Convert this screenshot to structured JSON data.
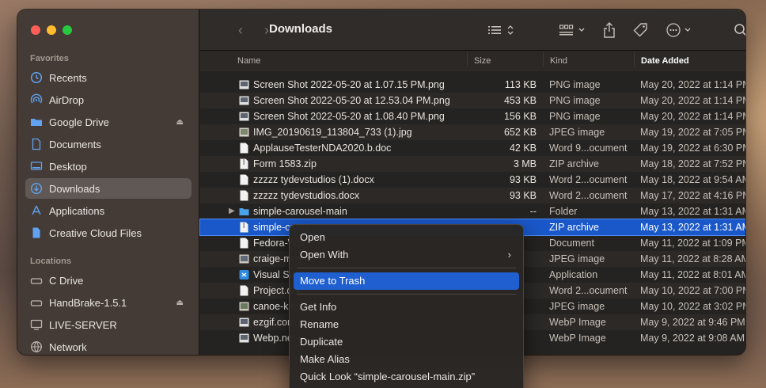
{
  "window": {
    "title": "Downloads"
  },
  "sidebar": {
    "favorites_label": "Favorites",
    "locations_label": "Locations",
    "favorites": [
      {
        "label": "Recents",
        "icon": "clock-icon"
      },
      {
        "label": "AirDrop",
        "icon": "airdrop-icon"
      },
      {
        "label": "Google Drive",
        "icon": "folder-icon",
        "eject": true
      },
      {
        "label": "Documents",
        "icon": "document-icon"
      },
      {
        "label": "Desktop",
        "icon": "desktop-icon"
      },
      {
        "label": "Downloads",
        "icon": "download-icon",
        "active": true
      },
      {
        "label": "Applications",
        "icon": "applications-icon"
      },
      {
        "label": "Creative Cloud Files",
        "icon": "document-icon"
      }
    ],
    "locations": [
      {
        "label": "C Drive",
        "icon": "drive-icon"
      },
      {
        "label": "HandBrake-1.5.1",
        "icon": "drive-icon",
        "eject": true
      },
      {
        "label": "LIVE-SERVER",
        "icon": "monitor-icon"
      },
      {
        "label": "Network",
        "icon": "globe-icon"
      }
    ]
  },
  "columns": {
    "name": "Name",
    "size": "Size",
    "kind": "Kind",
    "date": "Date Added"
  },
  "files": [
    {
      "name": "Screen Shot 2022-05-20 at 1.07.15 PM.png",
      "size": "113 KB",
      "kind": "PNG image",
      "date": "May 20, 2022 at 1:14 PM",
      "icon": "image-icon"
    },
    {
      "name": "Screen Shot 2022-05-20 at 12.53.04 PM.png",
      "size": "453 KB",
      "kind": "PNG image",
      "date": "May 20, 2022 at 1:14 PM",
      "icon": "image-icon"
    },
    {
      "name": "Screen Shot 2022-05-20 at 1.08.40 PM.png",
      "size": "156 KB",
      "kind": "PNG image",
      "date": "May 20, 2022 at 1:14 PM",
      "icon": "image-icon"
    },
    {
      "name": "IMG_20190619_113804_733 (1).jpg",
      "size": "652 KB",
      "kind": "JPEG image",
      "date": "May 19, 2022 at 7:05 PM",
      "icon": "image-icon"
    },
    {
      "name": "ApplauseTesterNDA2020.b.doc",
      "size": "42 KB",
      "kind": "Word 9...ocument",
      "date": "May 19, 2022 at 6:30 PM",
      "icon": "doc-icon"
    },
    {
      "name": "Form 1583.zip",
      "size": "3 MB",
      "kind": "ZIP archive",
      "date": "May 18, 2022 at 7:52 PM",
      "icon": "zip-icon"
    },
    {
      "name": "zzzzz tydevstudios (1).docx",
      "size": "93 KB",
      "kind": "Word 2...ocument",
      "date": "May 18, 2022 at 9:54 AM",
      "icon": "doc-icon"
    },
    {
      "name": "zzzzz tydevstudios.docx",
      "size": "93 KB",
      "kind": "Word 2...ocument",
      "date": "May 17, 2022 at 4:16 PM",
      "icon": "doc-icon"
    },
    {
      "name": "simple-carousel-main",
      "size": "--",
      "kind": "Folder",
      "date": "May 13, 2022 at 1:31 AM",
      "icon": "folder-icon",
      "folder": true
    },
    {
      "name": "simple-carou",
      "size": "",
      "kind": "ZIP archive",
      "date": "May 13, 2022 at 1:31 AM",
      "icon": "zip-icon",
      "selected": true
    },
    {
      "name": "Fedora-Wor",
      "size": "",
      "kind": "Document",
      "date": "May 11, 2022 at 1:09 PM",
      "icon": "doc-icon"
    },
    {
      "name": "craige-mcg",
      "size": "",
      "kind": "JPEG image",
      "date": "May 11, 2022 at 8:28 AM",
      "icon": "image-icon"
    },
    {
      "name": "Visual Stud",
      "size": "",
      "kind": "Application",
      "date": "May 11, 2022 at 8:01 AM",
      "icon": "app-icon"
    },
    {
      "name": "Project.doc",
      "size": "",
      "kind": "Word 2...ocument",
      "date": "May 10, 2022 at 7:00 PM",
      "icon": "doc-icon"
    },
    {
      "name": "canoe-kaya",
      "size": "",
      "kind": "JPEG image",
      "date": "May 10, 2022 at 3:02 PM",
      "icon": "image-icon"
    },
    {
      "name": "ezgif.com-g",
      "size": "",
      "kind": "WebP Image",
      "date": "May 9, 2022 at 9:46 PM",
      "icon": "image-icon"
    },
    {
      "name": "Webp.net-r",
      "size": "",
      "kind": "WebP Image",
      "date": "May 9, 2022 at 9:08 AM",
      "icon": "image-icon"
    }
  ],
  "context_menu": {
    "open": "Open",
    "open_with": "Open With",
    "move_to_trash": "Move to Trash",
    "get_info": "Get Info",
    "rename": "Rename",
    "duplicate": "Duplicate",
    "make_alias": "Make Alias",
    "quick_look": "Quick Look “simple-carousel-main.zip”"
  }
}
